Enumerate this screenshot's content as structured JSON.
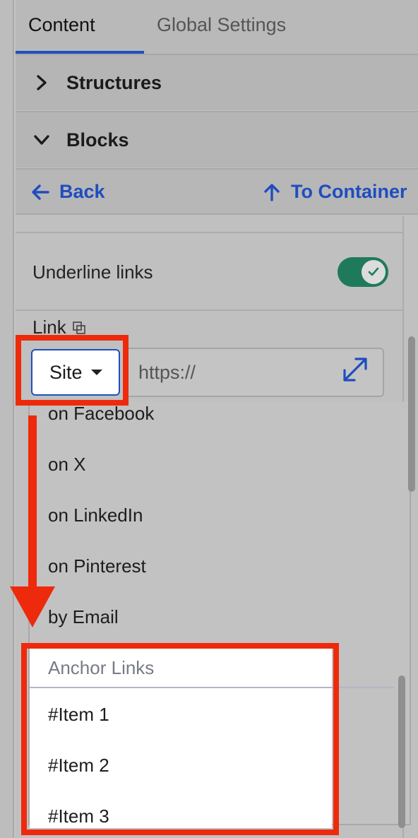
{
  "tabs": [
    {
      "label": "Content",
      "active": true
    },
    {
      "label": "Global Settings",
      "active": false
    }
  ],
  "accordion": {
    "structures_label": "Structures",
    "blocks_label": "Blocks"
  },
  "nav": {
    "back_label": "Back",
    "to_container_label": "To Container"
  },
  "settings": {
    "underline_links_label": "Underline links",
    "underline_links_enabled": true,
    "link_label": "Link"
  },
  "link_field": {
    "type_selected": "Site",
    "url_value": "https://"
  },
  "dropdown": {
    "options": [
      "on Facebook",
      "on X",
      "on LinkedIn",
      "on Pinterest",
      "by Email"
    ],
    "anchor_header": "Anchor Links",
    "anchor_options": [
      "#Item 1",
      "#Item 2",
      "#Item 3"
    ]
  },
  "colors": {
    "accent": "#1e4fbf",
    "toggle_on": "#1f7a5c",
    "annotation": "#ee2a0c"
  }
}
